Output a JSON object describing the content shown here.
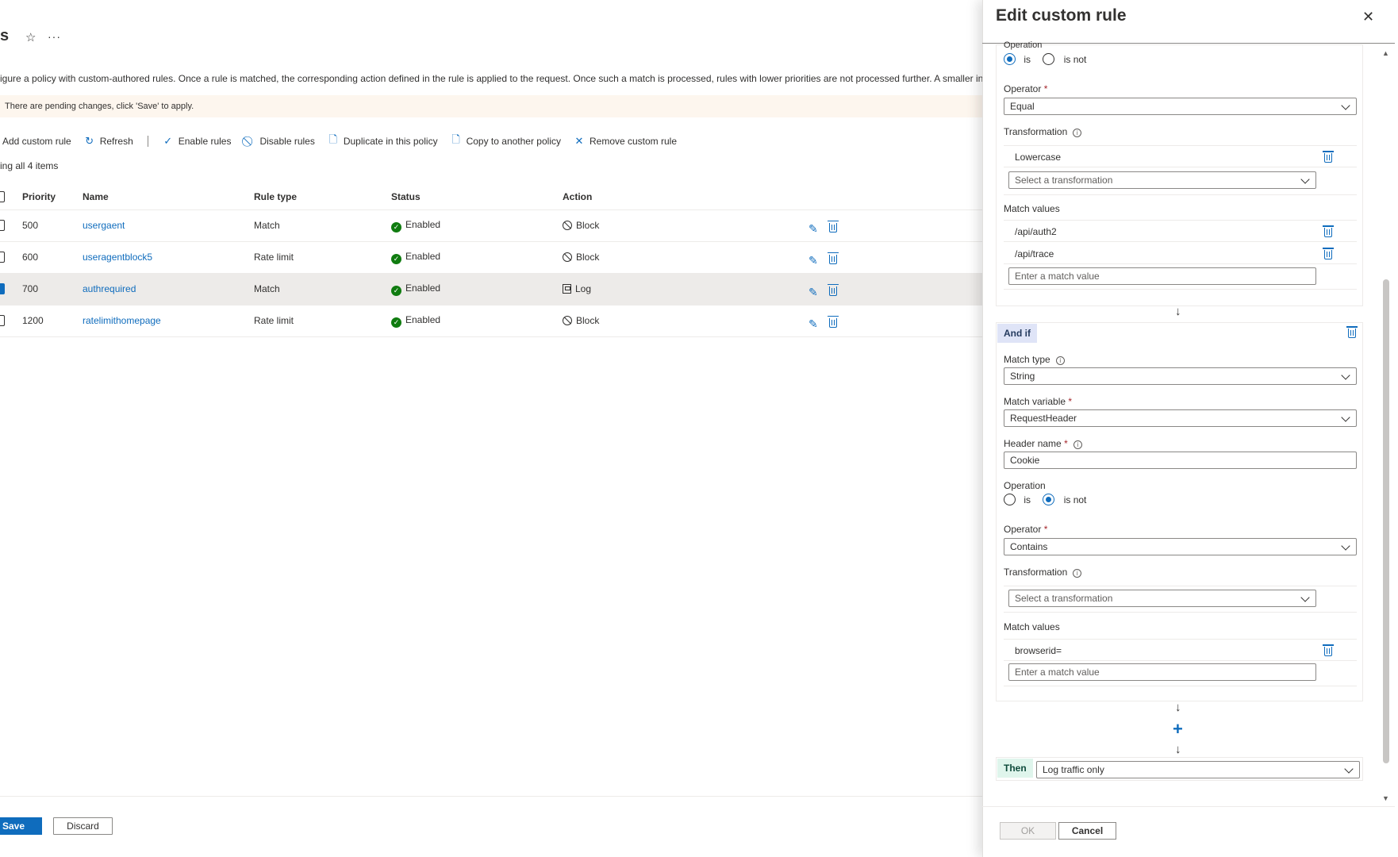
{
  "page": {
    "title": "s",
    "description": "igure a policy with custom-authored rules. Once a rule is matched, the corresponding action defined in the rule is applied to the request. Once such a match is processed, rules with lower priorities are not processed further. A smaller integer valu",
    "pending_notice": "There are pending changes, click 'Save' to apply.",
    "showing": "ing all 4 items"
  },
  "toolbar": {
    "add": "Add custom rule",
    "refresh": "Refresh",
    "enable": "Enable rules",
    "disable": "Disable rules",
    "duplicate": "Duplicate in this policy",
    "copy": "Copy to another policy",
    "remove": "Remove custom rule"
  },
  "table": {
    "headers": {
      "priority": "Priority",
      "name": "Name",
      "rule_type": "Rule type",
      "status": "Status",
      "action": "Action"
    },
    "rows": [
      {
        "priority": "500",
        "name": "usergaent",
        "rule_type": "Match",
        "status": "Enabled",
        "action": "Block"
      },
      {
        "priority": "600",
        "name": "useragentblock5",
        "rule_type": "Rate limit",
        "status": "Enabled",
        "action": "Block"
      },
      {
        "priority": "700",
        "name": "authrequired",
        "rule_type": "Match",
        "status": "Enabled",
        "action": "Log"
      },
      {
        "priority": "1200",
        "name": "ratelimithomepage",
        "rule_type": "Rate limit",
        "status": "Enabled",
        "action": "Block"
      }
    ]
  },
  "footer": {
    "save": "Save",
    "discard": "Discard"
  },
  "panel": {
    "title": "Edit custom rule",
    "cond1": {
      "operation_label": "Operation",
      "op_is": "is",
      "op_is_not": "is not",
      "operator_label": "Operator",
      "operator_value": "Equal",
      "transformation_label": "Transformation",
      "transformation_item": "Lowercase",
      "transformation_placeholder": "Select a transformation",
      "match_values_label": "Match values",
      "match_values": [
        "/api/auth2",
        "/api/trace"
      ],
      "match_placeholder": "Enter a match value"
    },
    "and_if": "And if",
    "cond2": {
      "match_type_label": "Match type",
      "match_type_value": "String",
      "match_variable_label": "Match variable",
      "match_variable_value": "RequestHeader",
      "header_name_label": "Header name",
      "header_name_value": "Cookie",
      "operation_label": "Operation",
      "op_is": "is",
      "op_is_not": "is not",
      "operator_label": "Operator",
      "operator_value": "Contains",
      "transformation_label": "Transformation",
      "transformation_placeholder": "Select a transformation",
      "match_values_label": "Match values",
      "match_values": [
        "browserid="
      ],
      "match_placeholder": "Enter a match value"
    },
    "then": "Then",
    "then_value": "Log traffic only",
    "ok": "OK",
    "cancel": "Cancel"
  }
}
